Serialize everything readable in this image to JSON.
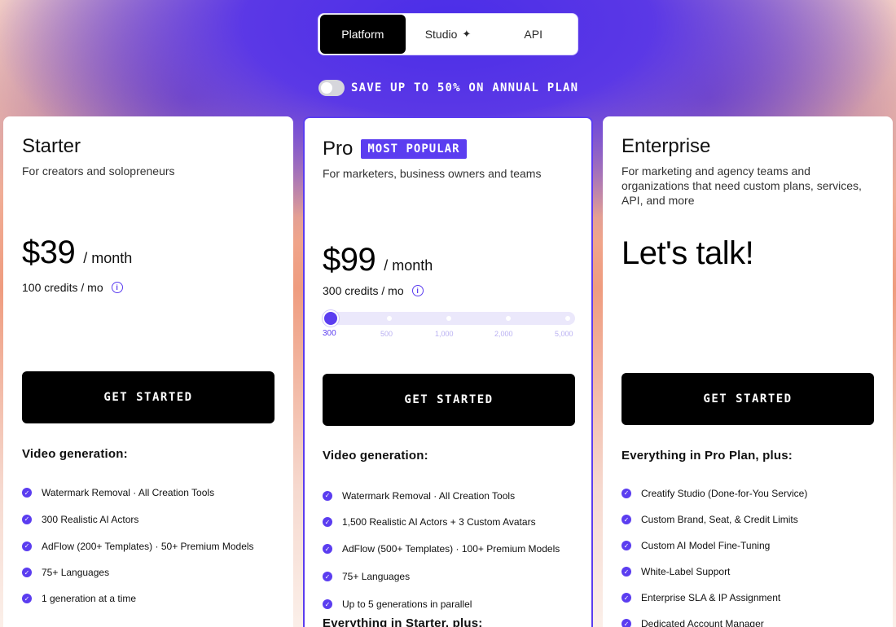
{
  "tabs": [
    {
      "label": "Platform",
      "active": true
    },
    {
      "label": "Studio",
      "icon": "sparkle-icon",
      "glyph": "✦"
    },
    {
      "label": "API"
    }
  ],
  "annual": {
    "label": "SAVE UP TO 50% ON ANNUAL PLAN",
    "enabled": false
  },
  "colors": {
    "accent": "#5b3df0",
    "cta": "#000000"
  },
  "plans": {
    "starter": {
      "name": "Starter",
      "description": "For creators and solopreneurs",
      "price": "$39",
      "period": "/ month",
      "credits": "100 credits / mo",
      "cta": "GET STARTED",
      "section_title": "Video generation:",
      "features": [
        "Watermark Removal · All Creation Tools",
        "300 Realistic AI Actors",
        "AdFlow (200+ Templates) · 50+ Premium Models",
        "75+ Languages",
        "1 generation at a time"
      ]
    },
    "pro": {
      "name": "Pro",
      "badge": "MOST POPULAR",
      "description": "For marketers, business owners and teams",
      "price": "$99",
      "period": "/ month",
      "credits": "300 credits / mo",
      "slider": {
        "stops": [
          "300",
          "500",
          "1,000",
          "2,000",
          "5,000"
        ],
        "selected": "300"
      },
      "cta": "GET STARTED",
      "section_title": "Video generation:",
      "features": [
        "Watermark Removal · All Creation Tools",
        "1,500 Realistic AI Actors + 3 Custom Avatars",
        "AdFlow (500+ Templates) · 100+ Premium Models",
        "75+ Languages",
        "Up to 5 generations in parallel"
      ],
      "section_title_2": "Everything in Starter, plus:"
    },
    "enterprise": {
      "name": "Enterprise",
      "description": "For marketing and agency teams and organizations that need custom plans, services, API, and more",
      "headline": "Let's talk!",
      "cta": "GET STARTED",
      "section_title": "Everything in Pro Plan, plus:",
      "features": [
        "Creatify Studio (Done-for-You Service)",
        "Custom Brand, Seat, & Credit Limits",
        "Custom AI Model Fine-Tuning",
        "White-Label Support",
        "Enterprise SLA & IP Assignment",
        "Dedicated Account Manager"
      ]
    }
  }
}
